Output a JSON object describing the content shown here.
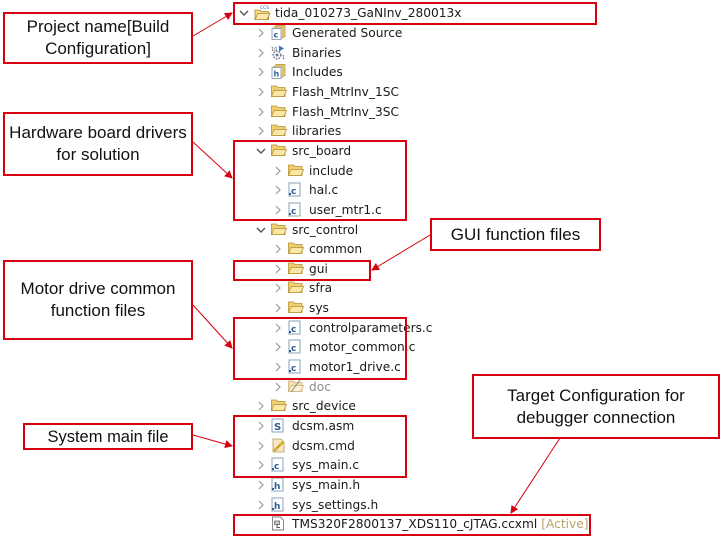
{
  "project": {
    "name": "tida_010273_GaNInv_280013x",
    "badge": "CCS"
  },
  "tree": [
    {
      "label": "Generated Source",
      "icon": "generated-source-icon",
      "level": 1,
      "twisty": "collapsed"
    },
    {
      "label": "Binaries",
      "icon": "binaries-icon",
      "level": 1,
      "twisty": "collapsed"
    },
    {
      "label": "Includes",
      "icon": "includes-icon",
      "level": 1,
      "twisty": "collapsed"
    },
    {
      "label": "Flash_MtrInv_1SC",
      "icon": "folder-icon",
      "level": 1,
      "twisty": "collapsed"
    },
    {
      "label": "Flash_MtrInv_3SC",
      "icon": "folder-icon",
      "level": 1,
      "twisty": "collapsed"
    },
    {
      "label": "libraries",
      "icon": "folder-icon",
      "level": 1,
      "twisty": "collapsed"
    },
    {
      "label": "src_board",
      "icon": "folder-icon",
      "level": 1,
      "twisty": "expanded"
    },
    {
      "label": "include",
      "icon": "folder-icon",
      "level": 2,
      "twisty": "collapsed"
    },
    {
      "label": "hal.c",
      "icon": "c-file-icon",
      "level": 2,
      "twisty": "collapsed"
    },
    {
      "label": "user_mtr1.c",
      "icon": "c-file-icon",
      "level": 2,
      "twisty": "collapsed"
    },
    {
      "label": "src_control",
      "icon": "folder-icon",
      "level": 1,
      "twisty": "expanded"
    },
    {
      "label": "common",
      "icon": "folder-icon",
      "level": 2,
      "twisty": "collapsed"
    },
    {
      "label": "gui",
      "icon": "folder-icon",
      "level": 2,
      "twisty": "collapsed"
    },
    {
      "label": "sfra",
      "icon": "folder-icon",
      "level": 2,
      "twisty": "collapsed"
    },
    {
      "label": "sys",
      "icon": "folder-icon",
      "level": 2,
      "twisty": "collapsed"
    },
    {
      "label": "controlparameters.c",
      "icon": "c-file-icon",
      "level": 2,
      "twisty": "collapsed"
    },
    {
      "label": "motor_common.c",
      "icon": "c-file-icon",
      "level": 2,
      "twisty": "collapsed"
    },
    {
      "label": "motor1_drive.c",
      "icon": "c-file-icon",
      "level": 2,
      "twisty": "collapsed"
    },
    {
      "label": "doc",
      "icon": "excluded-folder-icon",
      "level": 2,
      "twisty": "collapsed",
      "dim": true
    },
    {
      "label": "src_device",
      "icon": "folder-icon",
      "level": 1,
      "twisty": "collapsed"
    },
    {
      "label": "dcsm.asm",
      "icon": "asm-file-icon",
      "level": 1,
      "twisty": "collapsed"
    },
    {
      "label": "dcsm.cmd",
      "icon": "cmd-file-icon",
      "level": 1,
      "twisty": "collapsed"
    },
    {
      "label": "sys_main.c",
      "icon": "c-file-icon",
      "level": 1,
      "twisty": "collapsed"
    },
    {
      "label": "sys_main.h",
      "icon": "h-file-icon",
      "level": 1,
      "twisty": "collapsed"
    },
    {
      "label": "sys_settings.h",
      "icon": "h-file-icon",
      "level": 1,
      "twisty": "collapsed"
    },
    {
      "label": "TMS320F2800137_XDS110_cJTAG.ccxml",
      "icon": "target-config-icon",
      "level": 1,
      "twisty": "none",
      "suffix": "[Active]"
    }
  ],
  "callouts": {
    "project": "Project name[Build Configuration]",
    "hardware": "Hardware board drivers for solution",
    "gui": "GUI function files",
    "motor": "Motor drive common function files",
    "system": "System main file",
    "target": "Target Configuration for debugger connection"
  },
  "colors": {
    "annotation_red": "#d8000e",
    "folder_yellow": "#e8c66a",
    "active_tag": "#b8a36a"
  }
}
